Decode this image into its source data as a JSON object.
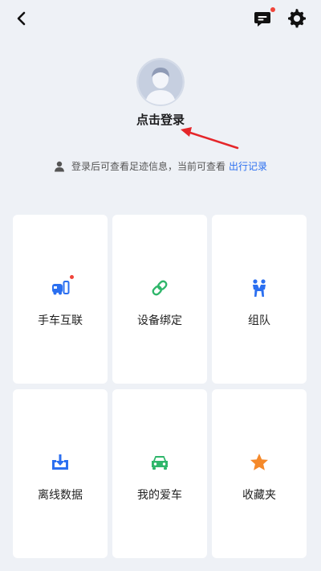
{
  "header": {
    "back_icon": "back-arrow-icon",
    "message_icon": "message-icon",
    "settings_icon": "gear-icon",
    "badge_color": "#f0443a"
  },
  "profile": {
    "login_label": "点击登录",
    "hint_text": "登录后可查看足迹信息，当前可查看",
    "hint_link": "出行记录"
  },
  "colors": {
    "background": "#eef1f6",
    "accent_blue": "#2b6ff0",
    "green": "#2fb66a",
    "orange": "#f5892a",
    "arrow_red": "#e5262a"
  },
  "grid": [
    {
      "label": "手车互联",
      "icon": "phone-car-link-icon",
      "badge": true
    },
    {
      "label": "设备绑定",
      "icon": "link-chain-icon",
      "badge": false
    },
    {
      "label": "组队",
      "icon": "team-people-icon",
      "badge": false
    },
    {
      "label": "离线数据",
      "icon": "download-box-icon",
      "badge": false
    },
    {
      "label": "我的爱车",
      "icon": "car-icon",
      "badge": false
    },
    {
      "label": "收藏夹",
      "icon": "star-icon",
      "badge": false
    }
  ]
}
